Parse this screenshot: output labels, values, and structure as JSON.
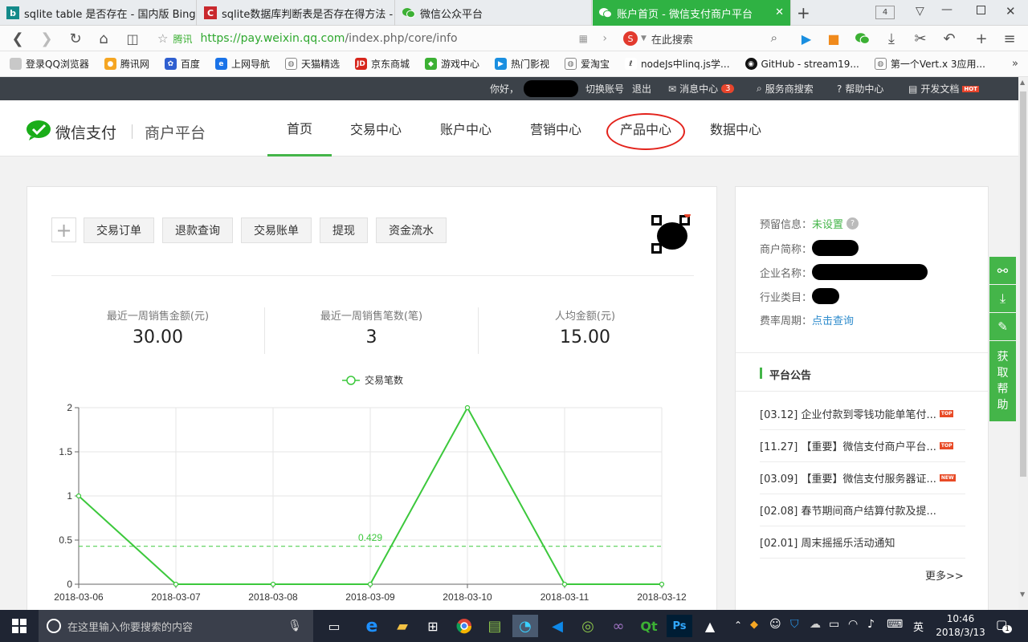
{
  "browser": {
    "tabs": [
      {
        "title": "sqlite table 是否存在 - 国内版 Bing",
        "icon": "bing-icon",
        "active": false
      },
      {
        "title": "sqlite数据库判断表是否存在得方法 -",
        "icon": "csdn-icon",
        "active": false
      },
      {
        "title": "微信公众平台",
        "icon": "wechat-icon",
        "active": false
      },
      {
        "title": "账户首页 - 微信支付商户平台",
        "icon": "wechat-icon",
        "active": true
      }
    ],
    "tab_count": "4",
    "address": {
      "site_label": "腾讯",
      "url_https": "https://",
      "url_domain": "pay.weixin.qq.com",
      "url_path": "/index.php/core/info"
    },
    "search_placeholder": "在此搜索",
    "bookmarks": [
      "登录QQ浏览器",
      "腾讯网",
      "百度",
      "上网导航",
      "天猫精选",
      "京东商城",
      "游戏中心",
      "热门影视",
      "爱淘宝",
      "nodeJs中linq.js学...",
      "GitHub - stream19...",
      "第一个Vert.x 3应用..."
    ]
  },
  "topbar": {
    "greeting": "你好，",
    "switch_account": "切换账号",
    "logout": "退出",
    "messages": "消息中心",
    "message_count": "3",
    "provider_search": "服务商搜索",
    "help": "帮助中心",
    "docs": "开发文档",
    "hot_badge": "HOT"
  },
  "header": {
    "logo_text": "微信支付",
    "platform": "商户平台",
    "nav": [
      "首页",
      "交易中心",
      "账户中心",
      "营销中心",
      "产品中心",
      "数据中心"
    ],
    "active_nav": "首页"
  },
  "quick_actions": [
    "交易订单",
    "退款查询",
    "交易账单",
    "提现",
    "资金流水"
  ],
  "stats": [
    {
      "label": "最近一周销售金额(元)",
      "value": "30.00"
    },
    {
      "label": "最近一周销售笔数(笔)",
      "value": "3"
    },
    {
      "label": "人均金额(元)",
      "value": "15.00"
    }
  ],
  "chart_data": {
    "type": "line",
    "legend": "交易笔数",
    "series": [
      {
        "name": "交易笔数",
        "x": [
          "2018-03-06",
          "2018-03-07",
          "2018-03-08",
          "2018-03-09",
          "2018-03-10",
          "2018-03-11",
          "2018-03-12"
        ],
        "values": [
          1,
          0,
          0,
          0,
          2,
          0,
          0
        ]
      }
    ],
    "average_line": {
      "value": 0.429,
      "label": "0.429"
    },
    "ylim": [
      0,
      2
    ],
    "yticks": [
      "0",
      "0.5",
      "1",
      "1.5",
      "2"
    ],
    "color": "#3cc83c",
    "grid": true
  },
  "account_info": {
    "reserve_label": "预留信息：",
    "reserve_value": "未设置",
    "short_name_label": "商户简称：",
    "company_label": "企业名称：",
    "industry_label": "行业类目：",
    "fee_cycle_label": "费率周期：",
    "fee_cycle_link": "点击查询"
  },
  "announcements": {
    "title": "平台公告",
    "items": [
      {
        "text": "[03.12] 企业付款到零钱功能单笔付...",
        "badge": "TOP"
      },
      {
        "text": "[11.27] 【重要】微信支付商户平台...",
        "badge": "TOP"
      },
      {
        "text": "[03.09] 【重要】微信支付服务器证...",
        "badge": "NEW"
      },
      {
        "text": "[02.08] 春节期间商户结算付款及提...",
        "badge": ""
      },
      {
        "text": "[02.01] 周末摇摇乐活动通知",
        "badge": ""
      }
    ],
    "more": "更多>>"
  },
  "side_tools": {
    "help_text": "获取帮助"
  },
  "taskbar": {
    "search_placeholder": "在这里输入你要搜索的内容",
    "ime": "英",
    "time": "10:46",
    "date": "2018/3/13",
    "notifications": "1"
  },
  "colors": {
    "accent": "#44b549",
    "topbar": "#3c4249",
    "tab_active": "#2fb243",
    "link": "#2f8ccd"
  }
}
